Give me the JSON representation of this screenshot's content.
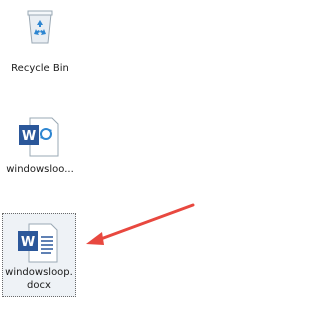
{
  "desktop": {
    "icons": [
      {
        "label": "Recycle Bin",
        "icon": "recycle-bin-icon"
      },
      {
        "label": "windowsloo...",
        "icon": "word-document-icon"
      },
      {
        "label_line1": "windowsloop.",
        "label_line2": "docx",
        "icon": "word-document-icon"
      }
    ]
  },
  "colors": {
    "accent": "#2b579a",
    "arrow": "#e8483f",
    "recycle": "#2e86d1"
  }
}
